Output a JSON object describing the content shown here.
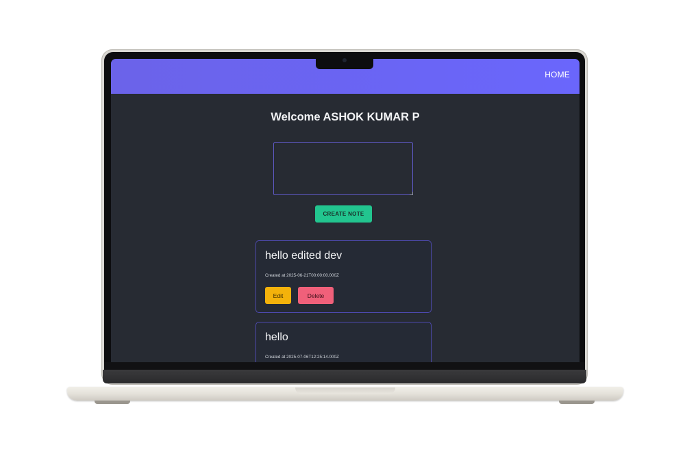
{
  "navbar": {
    "home_label": "HOME",
    "color": "#6a66fc"
  },
  "welcome": {
    "text": "Welcome ASHOK KUMAR P"
  },
  "note_input": {
    "value": "",
    "placeholder": ""
  },
  "create_button": {
    "label": "CREATE NOTE",
    "color": "#22c58f"
  },
  "notes": [
    {
      "title": "hello edited dev",
      "created": "Created at 2025-06-21T00:00:00.000Z",
      "edit_label": "Edit",
      "delete_label": "Delete"
    },
    {
      "title": "hello",
      "created": "Created at 2025-07-06T12:25:14.000Z"
    }
  ],
  "colors": {
    "background": "#272b33",
    "edit_button": "#f4b20b",
    "delete_button": "#f0607a",
    "card_border": "#4e4ab0"
  }
}
